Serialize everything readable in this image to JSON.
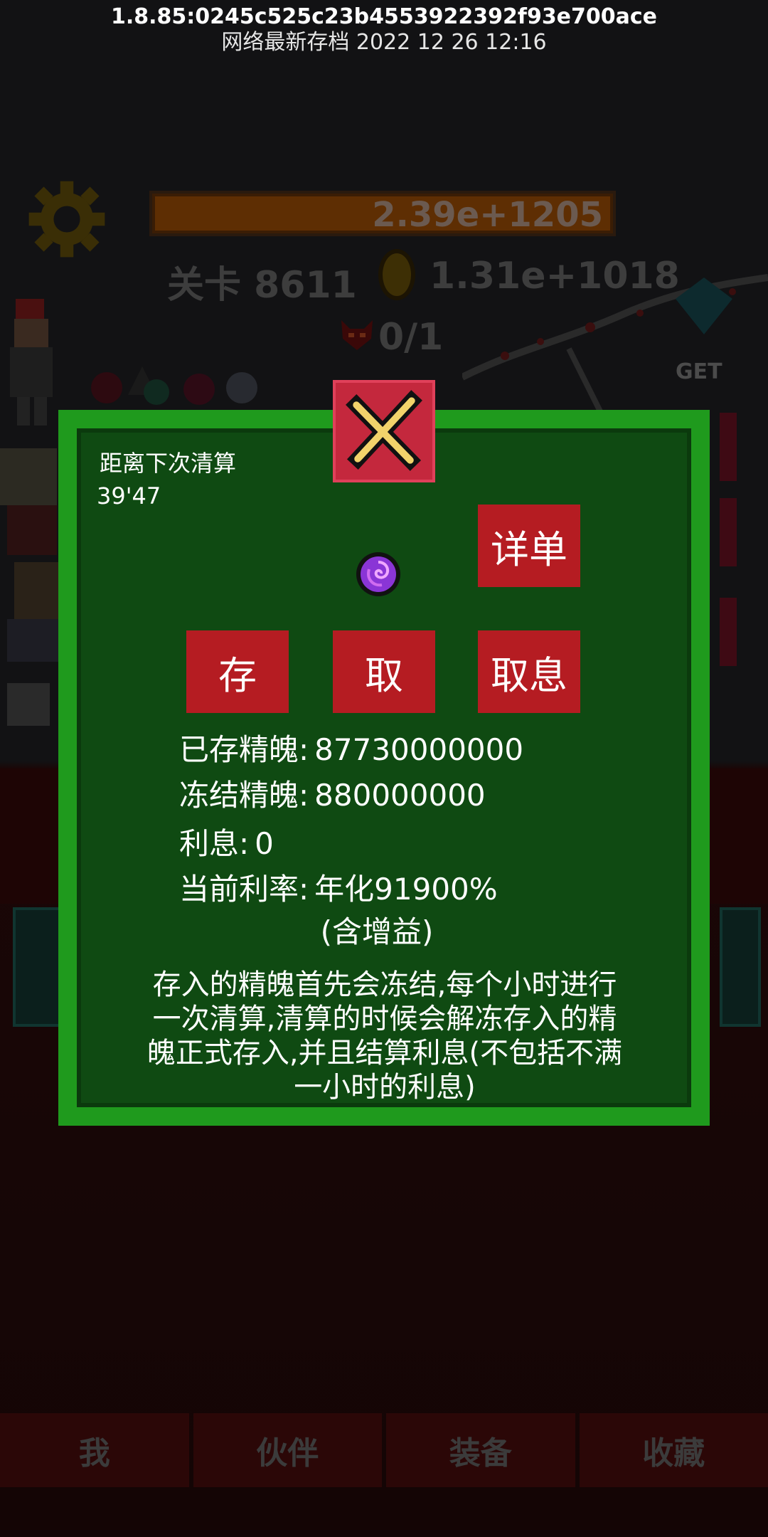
{
  "header": {
    "version": "1.8.85:0245c525c23b4553922392f93e700ace",
    "save_time": "网络最新存档  2022  12  26  12:16"
  },
  "background": {
    "boss_hp": "2.39e+1205",
    "stage": "关卡 8611",
    "gold": "1.31e+1018",
    "kills": "0/1",
    "get_label": "GET"
  },
  "dialog": {
    "timer_label": "距离下次清算",
    "timer_value": "39'47",
    "detail_button": "详单",
    "deposit_button": "存",
    "withdraw_button": "取",
    "withdraw_interest_button": "取息",
    "stored_label": "已存精魄:",
    "stored_value": "87730000000",
    "frozen_label": "冻结精魄:",
    "frozen_value": "880000000",
    "interest_label": "利息:",
    "interest_value": "0",
    "rate_label": "当前利率:",
    "rate_value": "年化91900%",
    "rate_note": "(含增益)",
    "description": "存入的精魄首先会冻结,每个小时进行一次清算,清算的时候会解冻存入的精魄正式存入,并且结算利息(不包括不满一小时的利息)"
  },
  "nav": {
    "me": "我",
    "partner": "伙伴",
    "equipment": "装备",
    "collection": "收藏"
  },
  "colors": {
    "dialog_border": "#1f9a1d",
    "dialog_body": "#0f4a12",
    "button_red": "#b51c22",
    "close_bg": "#c4283d"
  }
}
